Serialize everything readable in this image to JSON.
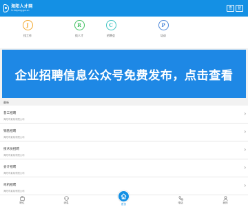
{
  "header": {
    "logo_title": "海阳人才网",
    "logo_subtitle": "hr.haiyang.gov.cn",
    "btn_search": "查",
    "btn_menu": "登"
  },
  "categories": [
    {
      "letter": "J",
      "label": "找工作"
    },
    {
      "letter": "R",
      "label": "找人才"
    },
    {
      "letter": "C",
      "label": "招聘会"
    },
    {
      "letter": "P",
      "label": "培训"
    }
  ],
  "banner": {
    "text": "企业招聘信息公众号免费发布，点击查看"
  },
  "section": {
    "title": "最新"
  },
  "list": [
    {
      "title": "普工招聘",
      "subtitle": "海阳市某某有限公司"
    },
    {
      "title": "销售招聘",
      "subtitle": "海阳市某某有限公司"
    },
    {
      "title": "技术员招聘",
      "subtitle": "海阳市某某有限公司"
    },
    {
      "title": "会计招聘",
      "subtitle": "海阳市某某有限公司"
    },
    {
      "title": "司机招聘",
      "subtitle": "海阳市某某有限公司"
    }
  ],
  "tabbar": {
    "jobs": "职位",
    "chat": "消息",
    "home": "首页",
    "phone": "电话",
    "me": "我的"
  },
  "colors": {
    "brand_blue": "#1490e4",
    "banner_blue": "#1e88e5"
  }
}
